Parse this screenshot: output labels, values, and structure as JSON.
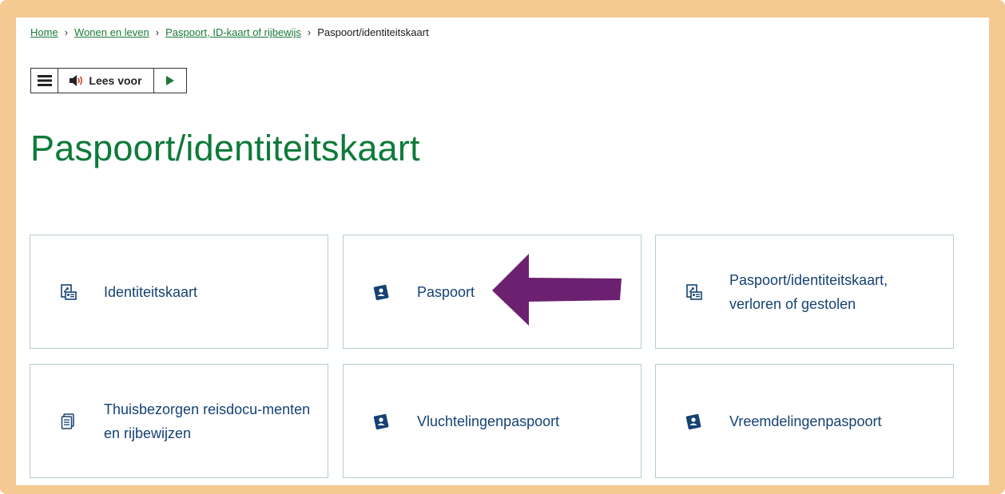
{
  "breadcrumb": {
    "items": [
      {
        "label": "Home"
      },
      {
        "label": "Wonen en leven"
      },
      {
        "label": "Paspoort, ID-kaart of rijbewijs"
      }
    ],
    "current": "Paspoort/identiteitskaart",
    "separator": "›"
  },
  "reader": {
    "listen_label": "Lees voor"
  },
  "page": {
    "title": "Paspoort/identiteitskaart"
  },
  "cards": [
    {
      "label": "Identiteitskaart",
      "icon": "id-card-icon"
    },
    {
      "label": "Paspoort",
      "icon": "passport-icon"
    },
    {
      "label": "Paspoort/identiteitskaart, verloren of gestolen",
      "icon": "id-card-icon"
    },
    {
      "label": "Thuisbezorgen reisdocu-menten en rijbewijzen",
      "icon": "document-icon"
    },
    {
      "label": "Vluchtelingenpaspoort",
      "icon": "passport-icon"
    },
    {
      "label": "Vreemdelingenpaspoort",
      "icon": "passport-icon"
    }
  ],
  "colors": {
    "frame": "#f5c992",
    "link": "#1b7a3a",
    "title": "#0e7a3a",
    "card_text": "#154273",
    "card_border": "#b5cfc1",
    "arrow": "#6b2170"
  }
}
